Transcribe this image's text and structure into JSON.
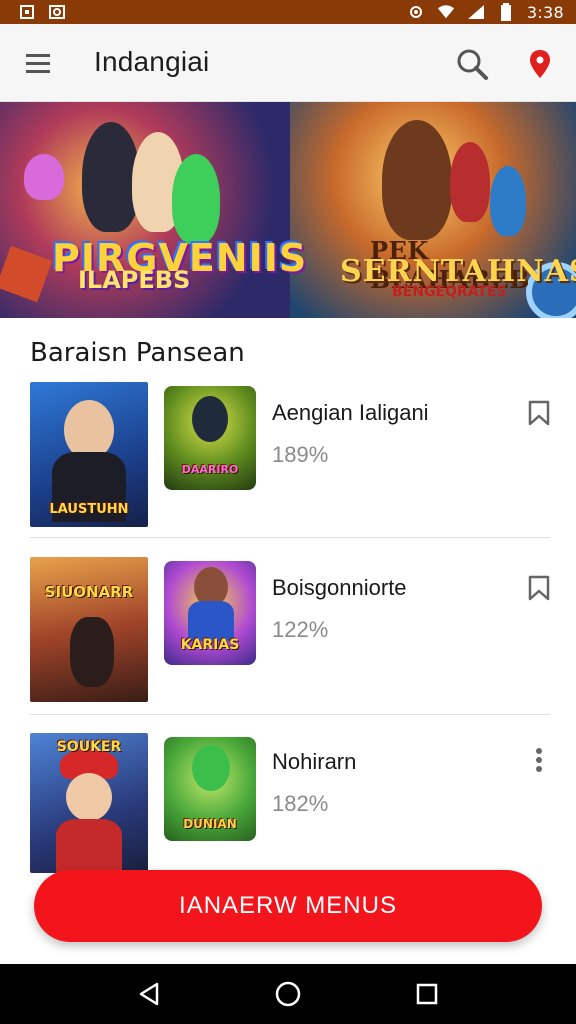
{
  "status_bar": {
    "time": "3:38",
    "icons": [
      "notification-icon",
      "gallery-icon",
      "settings-gear-icon",
      "wifi-icon",
      "signal-icon",
      "battery-icon"
    ]
  },
  "app_bar": {
    "title": "Indangiai",
    "icons": [
      "menu-icon",
      "search-icon",
      "location-pin-icon"
    ]
  },
  "banner": {
    "left_logo_line1": "PIRGVENIIS",
    "left_logo_line2": "ILAPEBS",
    "right_logo_top": "PEK BLAHABEB",
    "right_logo_main": "SERNTAHNAS",
    "right_logo_sub": "BENGEQRATES"
  },
  "section": {
    "title": "Baraisn Pansean"
  },
  "items": [
    {
      "thumb_a_label": "LAUSTUHN",
      "thumb_b_label": "DAARIRO",
      "title": "Aengian Ialigani",
      "subtitle": "189%",
      "action_icon": "bookmark-icon"
    },
    {
      "thumb_a_label": "SIUONARR",
      "thumb_b_label": "KARIAS",
      "title": "Boisgonniorte",
      "subtitle": "122%",
      "action_icon": "bookmark-icon"
    },
    {
      "thumb_a_label": "SOUKER",
      "thumb_b_label": "DUNIAN",
      "title": "Nohirarn",
      "subtitle": "182%",
      "action_icon": "more-vert-icon"
    }
  ],
  "cta": {
    "label": "IANAERW MENUS"
  },
  "nav": {
    "icons": [
      "back-icon",
      "home-icon",
      "recents-icon"
    ]
  },
  "colors": {
    "status_bar": "#8a3a06",
    "accent": "#f4141c",
    "pin": "#e0201e"
  }
}
